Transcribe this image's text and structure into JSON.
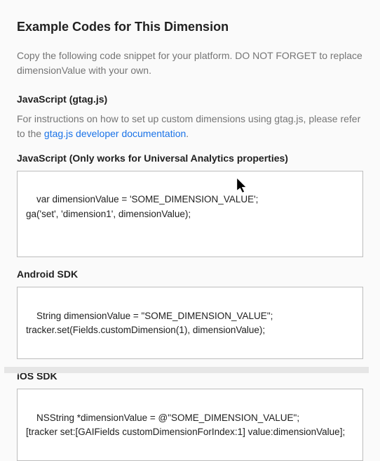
{
  "title": "Example Codes for This Dimension",
  "intro": "Copy the following code snippet for your platform. DO NOT FORGET to replace dimensionValue with your own.",
  "gtag": {
    "header": "JavaScript (gtag.js)",
    "desc_part1": "For instructions on how to set up custom dimensions using gtag.js, please refer to the ",
    "link_text": "gtag.js developer documentation",
    "desc_part2": "."
  },
  "js_universal": {
    "header": "JavaScript (Only works for Universal Analytics properties)",
    "code": "var dimensionValue = 'SOME_DIMENSION_VALUE';\nga('set', 'dimension1', dimensionValue);"
  },
  "android": {
    "header": "Android SDK",
    "code": "String dimensionValue = \"SOME_DIMENSION_VALUE\";\ntracker.set(Fields.customDimension(1), dimensionValue);"
  },
  "ios": {
    "header": "iOS SDK",
    "code": "NSString *dimensionValue = @\"SOME_DIMENSION_VALUE\";\n[tracker set:[GAIFields customDimensionForIndex:1] value:dimensionValue];"
  }
}
